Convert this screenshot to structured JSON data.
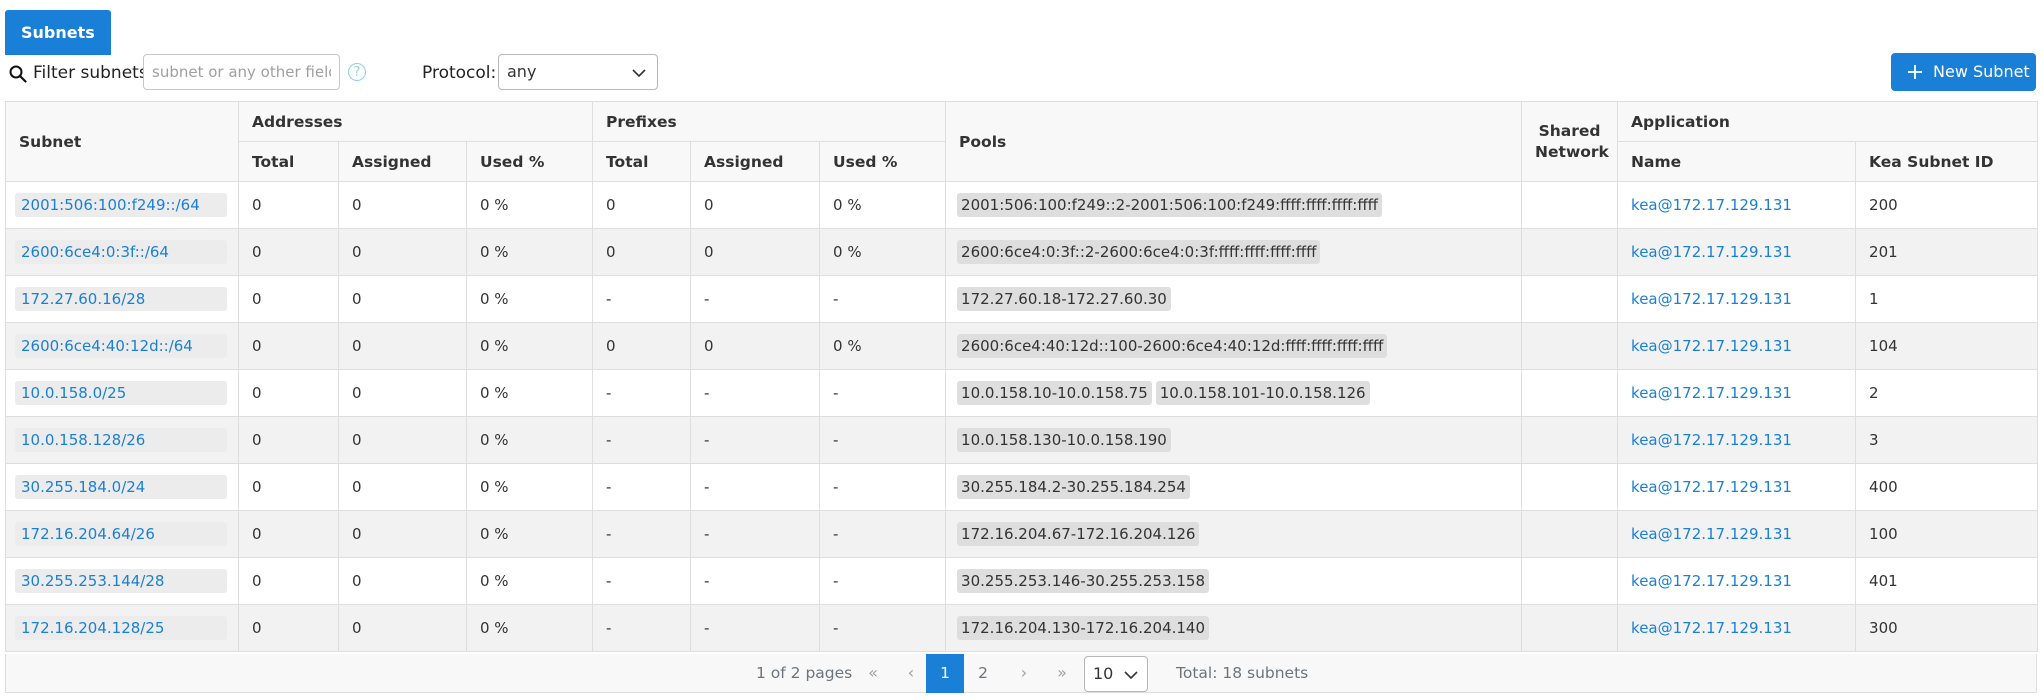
{
  "tabs": [
    {
      "label": "Subnets"
    }
  ],
  "filter": {
    "label": "Filter subnets:",
    "placeholder": "subnet or any other field",
    "help": "?"
  },
  "protocol": {
    "label": "Protocol:",
    "value": "any"
  },
  "new_button": {
    "label": "New Subnet"
  },
  "table": {
    "headers": {
      "subnet": "Subnet",
      "addresses": "Addresses",
      "prefixes": "Prefixes",
      "pools": "Pools",
      "shared_network": "Shared Network",
      "application": "Application",
      "total": "Total",
      "assigned": "Assigned",
      "used": "Used %",
      "name": "Name",
      "kea_subnet_id": "Kea Subnet ID"
    },
    "rows": [
      {
        "subnet": "2001:506:100:f249::/64",
        "addr_total": "0",
        "addr_assigned": "0",
        "addr_used": "0 %",
        "pref_total": "0",
        "pref_assigned": "0",
        "pref_used": "0 %",
        "pools": [
          "2001:506:100:f249::2-2001:506:100:f249:ffff:ffff:ffff:ffff"
        ],
        "shared_network": "",
        "app_name": "kea@172.17.129.131",
        "kea_id": "200"
      },
      {
        "subnet": "2600:6ce4:0:3f::/64",
        "addr_total": "0",
        "addr_assigned": "0",
        "addr_used": "0 %",
        "pref_total": "0",
        "pref_assigned": "0",
        "pref_used": "0 %",
        "pools": [
          "2600:6ce4:0:3f::2-2600:6ce4:0:3f:ffff:ffff:ffff:ffff"
        ],
        "shared_network": "",
        "app_name": "kea@172.17.129.131",
        "kea_id": "201"
      },
      {
        "subnet": "172.27.60.16/28",
        "addr_total": "0",
        "addr_assigned": "0",
        "addr_used": "0 %",
        "pref_total": "-",
        "pref_assigned": "-",
        "pref_used": "-",
        "pools": [
          "172.27.60.18-172.27.60.30"
        ],
        "shared_network": "",
        "app_name": "kea@172.17.129.131",
        "kea_id": "1"
      },
      {
        "subnet": "2600:6ce4:40:12d::/64",
        "addr_total": "0",
        "addr_assigned": "0",
        "addr_used": "0 %",
        "pref_total": "0",
        "pref_assigned": "0",
        "pref_used": "0 %",
        "pools": [
          "2600:6ce4:40:12d::100-2600:6ce4:40:12d:ffff:ffff:ffff:ffff"
        ],
        "shared_network": "",
        "app_name": "kea@172.17.129.131",
        "kea_id": "104"
      },
      {
        "subnet": "10.0.158.0/25",
        "addr_total": "0",
        "addr_assigned": "0",
        "addr_used": "0 %",
        "pref_total": "-",
        "pref_assigned": "-",
        "pref_used": "-",
        "pools": [
          "10.0.158.10-10.0.158.75",
          "10.0.158.101-10.0.158.126"
        ],
        "shared_network": "",
        "app_name": "kea@172.17.129.131",
        "kea_id": "2"
      },
      {
        "subnet": "10.0.158.128/26",
        "addr_total": "0",
        "addr_assigned": "0",
        "addr_used": "0 %",
        "pref_total": "-",
        "pref_assigned": "-",
        "pref_used": "-",
        "pools": [
          "10.0.158.130-10.0.158.190"
        ],
        "shared_network": "",
        "app_name": "kea@172.17.129.131",
        "kea_id": "3"
      },
      {
        "subnet": "30.255.184.0/24",
        "addr_total": "0",
        "addr_assigned": "0",
        "addr_used": "0 %",
        "pref_total": "-",
        "pref_assigned": "-",
        "pref_used": "-",
        "pools": [
          "30.255.184.2-30.255.184.254"
        ],
        "shared_network": "",
        "app_name": "kea@172.17.129.131",
        "kea_id": "400"
      },
      {
        "subnet": "172.16.204.64/26",
        "addr_total": "0",
        "addr_assigned": "0",
        "addr_used": "0 %",
        "pref_total": "-",
        "pref_assigned": "-",
        "pref_used": "-",
        "pools": [
          "172.16.204.67-172.16.204.126"
        ],
        "shared_network": "",
        "app_name": "kea@172.17.129.131",
        "kea_id": "100"
      },
      {
        "subnet": "30.255.253.144/28",
        "addr_total": "0",
        "addr_assigned": "0",
        "addr_used": "0 %",
        "pref_total": "-",
        "pref_assigned": "-",
        "pref_used": "-",
        "pools": [
          "30.255.253.146-30.255.253.158"
        ],
        "shared_network": "",
        "app_name": "kea@172.17.129.131",
        "kea_id": "401"
      },
      {
        "subnet": "172.16.204.128/25",
        "addr_total": "0",
        "addr_assigned": "0",
        "addr_used": "0 %",
        "pref_total": "-",
        "pref_assigned": "-",
        "pref_used": "-",
        "pools": [
          "172.16.204.130-172.16.204.140"
        ],
        "shared_network": "",
        "app_name": "kea@172.17.129.131",
        "kea_id": "300"
      }
    ]
  },
  "paginator": {
    "report": "1 of 2 pages",
    "first_icon": "«",
    "prev_icon": "‹",
    "next_icon": "›",
    "last_icon": "»",
    "pages": [
      "1",
      "2"
    ],
    "current_page": "1",
    "rows_per_page": "10",
    "total": "Total: 18 subnets"
  },
  "colors": {
    "accent": "#1a7fd6",
    "stripe": "#f2f2f2",
    "chip": "#dedede"
  },
  "icons": [
    "search-icon",
    "help-icon",
    "chevron-down-icon",
    "plus-icon",
    "first-page-icon",
    "prev-page-icon",
    "next-page-icon",
    "last-page-icon"
  ]
}
